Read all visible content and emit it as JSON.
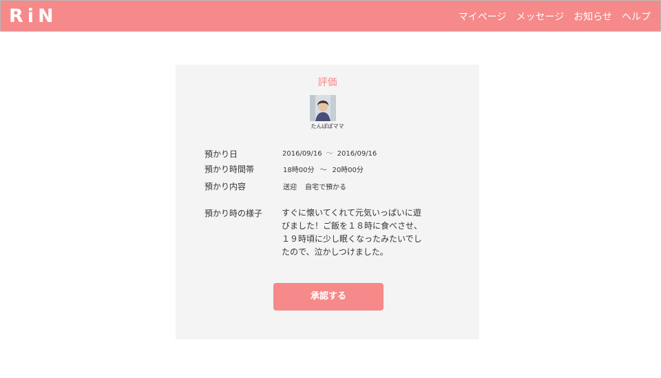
{
  "header": {
    "logo": "RiN",
    "nav": [
      "マイページ",
      "メッセージ",
      "お知らせ",
      "ヘルプ"
    ]
  },
  "card": {
    "title": "評価",
    "user_name": "たんぽぽママ",
    "labels": {
      "date": "預かり日",
      "time": "預かり時間帯",
      "content": "預かり内容",
      "notes": "預かり時の様子"
    },
    "date_start": "2016/09/16",
    "date_end": "2016/09/16",
    "range_sep": "～",
    "time_start": "18時00分",
    "time_end": "20時00分",
    "time_sep": "〜",
    "content_items": [
      "送迎",
      "自宅で預かる"
    ],
    "notes_text": "すぐに懐いてくれて元気いっぱいに遊びました！ご飯を１８時に食べさせ、１９時頃に少し眠くなったみたいでしたので、泣かしつけました。",
    "approve_label": "承認する"
  },
  "colors": {
    "accent": "#f68989",
    "card_bg": "#f4f4f4"
  },
  "icons": {
    "avatar": "user-photo"
  }
}
